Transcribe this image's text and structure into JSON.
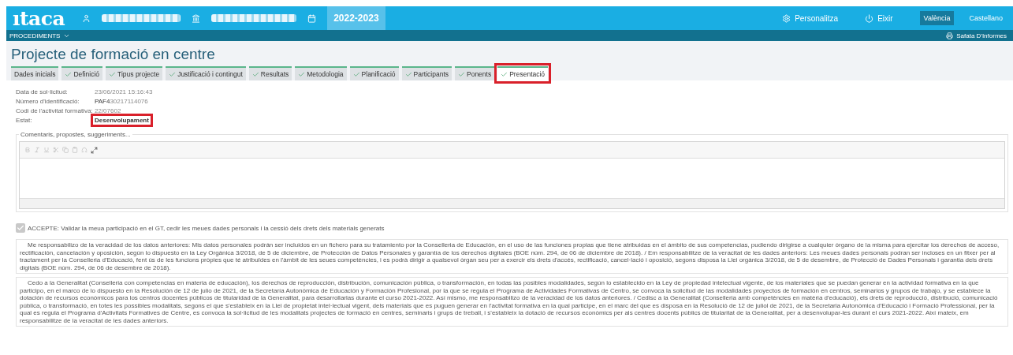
{
  "header": {
    "logo": "ıtaca",
    "year": "2022-2023",
    "actions": [
      {
        "kind": "settings",
        "label": "Personalitza"
      },
      {
        "kind": "power",
        "label": "Eixir"
      }
    ],
    "languages": [
      {
        "label": "València",
        "selected": true
      },
      {
        "label": "Castellano",
        "selected": false
      }
    ]
  },
  "subbar": {
    "menu": "PROCEDIMENTS",
    "reports": "Safata D'Informes"
  },
  "title": "Projecte de formació en centre",
  "tabs": [
    {
      "label": "Dades inicials",
      "done": false,
      "selected": false
    },
    {
      "label": "Definició",
      "done": true,
      "selected": false
    },
    {
      "label": "Tipus projecte",
      "done": true,
      "selected": false
    },
    {
      "label": "Justificació i contingut",
      "done": true,
      "selected": false
    },
    {
      "label": "Resultats",
      "done": true,
      "selected": false
    },
    {
      "label": "Metodologia",
      "done": true,
      "selected": false
    },
    {
      "label": "Planificació",
      "done": true,
      "selected": false
    },
    {
      "label": "Participants",
      "done": true,
      "selected": false
    },
    {
      "label": "Ponents",
      "done": true,
      "selected": false
    },
    {
      "label": "Presentació",
      "done": true,
      "selected": true
    }
  ],
  "fields": [
    {
      "label": "Data de sol·licitud:",
      "value": "23/06/2021 15:16:43",
      "strong": false,
      "highlighted": false
    },
    {
      "label": "Número d'identificació:",
      "value": "PAF4",
      "value_faint": "30217114076",
      "strong": false,
      "highlighted": false
    },
    {
      "label": "Codi de l'activitat formativa:",
      "value": "22/07602",
      "strong": false,
      "highlighted": false
    },
    {
      "label": "Estat:",
      "value": "Desenvolupament",
      "strong": true,
      "highlighted": true
    }
  ],
  "editor": {
    "legend": "Comentaris, propostes, suggeriments..."
  },
  "accept": {
    "checked": true,
    "disabled": true,
    "label": "ACCEPTE: Validar la meua participació en el GT, cedir les meues dades personals i la cessió dels drets dels materials generats"
  },
  "notices": [
    "Me responsabilizo de la veracidad de los datos anteriores: Mis datos personales podrán ser incluidos en un fichero para su tratamiento por la Conselleria de Educación, en el uso de las funciones propias que tiene atribuidas en el ámbito de sus competencias, pudiendo dirigirse a cualquier órgano de la misma para ejercitar los derechos de acceso, rectificación, cancelación y oposición, según lo dispuesto en la Ley Orgánica 3/2018, de 5 de diciembre, de Protección de Datos Personales y garantía de los derechos digitales (BOE núm. 294, de 06 de diciembre de 2018). / Em responsabilitze de la veracitat de les dades anteriors: Les meues dades personals podran ser incloses en un fitxer per al tractament per la Conselleria d'Educació, fent ús de les funcions pròpies que té atribuïdes en l'àmbit de les seues competències, i es podrà dirigir a qualsevol òrgan seu per a exercir els drets d'accés, rectificació, cancel·lació i oposició, segons disposa la Llei orgànica 3/2018, de 5 de desembre, de Protecció de Dades Personals i garantia dels drets digitals (BOE núm. 294, de 06 de desembre de 2018).",
    "Cedo a la Generalitat (Conselleria con competencias en materia de educación), los derechos de reproducción, distribución, comunicación pública, o transformación, en todas las posibles modalidades, según lo establecido en la Ley de propiedad intelectual vigente, de los materiales que se puedan generar en la actividad formativa en la que participo, en el marco de lo dispuesto en la Resolución de 12 de julio de 2021, de la Secretaría Autonómica de Educación y Formación Profesional, por la que se regula el Programa de Actividades Formativas de Centro, se convoca la solicitud de las modalidades proyectos de formación en centros, seminarios y grupos de trabajo, y se establece la dotación de recursos económicos para los centros docentes públicos de titularidad de la Generalitat, para desarrollarlas durante el curso 2021-2022. Así mismo, me responsabilizo de la veracidad de los datos anteriores. / Cedisc a la Generalitat (Conselleria amb competències en matèria d'educació), els drets de reproducció, distribució, comunicació pública, o transformació, en totes les possibles modalitats, segons el que s'estableix en la Llei de propietat intel·lectual vigent, dels materials que es puguen generar en l'activitat formativa en la qual participe, en el marc del que es disposa en la Resolució de 12 de juliol de 2021, de la Secretaria Autonòmica d'Educació i Formació Professional, per la qual es regula el Programa d'Activitats Formatives de Centre, es convoca la sol·licitud de les modalitats projectes de formació en centres, seminaris i grups de treball, i s'estableix la dotació de recursos econòmics per als centres docents públics de titularitat de la Generalitat, per a desenvolupar-les durant el curs 2021-2022. Així mateix, em responsabilitze de la veracitat de les dades anteriors."
  ]
}
